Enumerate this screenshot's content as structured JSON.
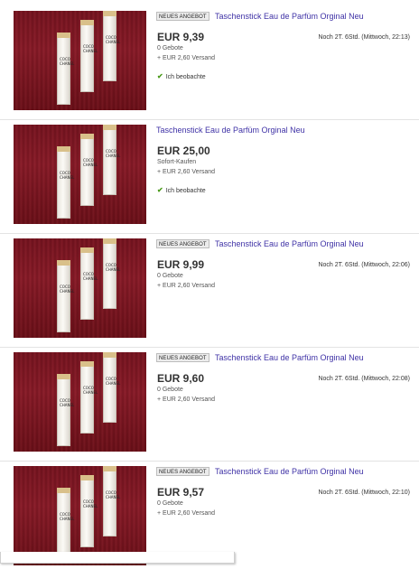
{
  "listings": [
    {
      "badge": "NEUES ANGEBOT",
      "title": "Taschenstick Eau de Parfüm Orginal Neu",
      "price": "EUR 9,39",
      "status": "0 Gebote",
      "shipping": "+ EUR 2,60 Versand",
      "time_left": "Noch 2T. 6Std. (Mittwoch, 22:13)",
      "watching": "Ich beobachte"
    },
    {
      "badge": "",
      "title": "Taschenstick Eau de Parfüm Orginal Neu",
      "price": "EUR 25,00",
      "status": "Sofort-Kaufen",
      "shipping": "+ EUR 2,60 Versand",
      "time_left": "",
      "watching": "Ich beobachte"
    },
    {
      "badge": "NEUES ANGEBOT",
      "title": "Taschenstick Eau de Parfüm Orginal Neu",
      "price": "EUR 9,99",
      "status": "0 Gebote",
      "shipping": "+ EUR 2,60 Versand",
      "time_left": "Noch 2T. 6Std. (Mittwoch, 22:06)",
      "watching": ""
    },
    {
      "badge": "NEUES ANGEBOT",
      "title": "Taschenstick Eau de Parfüm Orginal Neu",
      "price": "EUR 9,60",
      "status": "0 Gebote",
      "shipping": "+ EUR 2,60 Versand",
      "time_left": "Noch 2T. 6Std. (Mittwoch, 22:08)",
      "watching": ""
    },
    {
      "badge": "NEUES ANGEBOT",
      "title": "Taschenstick Eau de Parfüm Orginal Neu",
      "price": "EUR 9,57",
      "status": "0 Gebote",
      "shipping": "+ EUR 2,60 Versand",
      "time_left": "Noch 2T. 6Std. (Mittwoch, 22:10)",
      "watching": ""
    }
  ],
  "product_label": {
    "brand": "COCO",
    "sub": "CHANEL"
  },
  "colors": {
    "title_link": "#3f32a6",
    "check": "#4a9a1a",
    "background": "#7a1420"
  },
  "icons": {
    "watch": "checkmark-icon"
  }
}
